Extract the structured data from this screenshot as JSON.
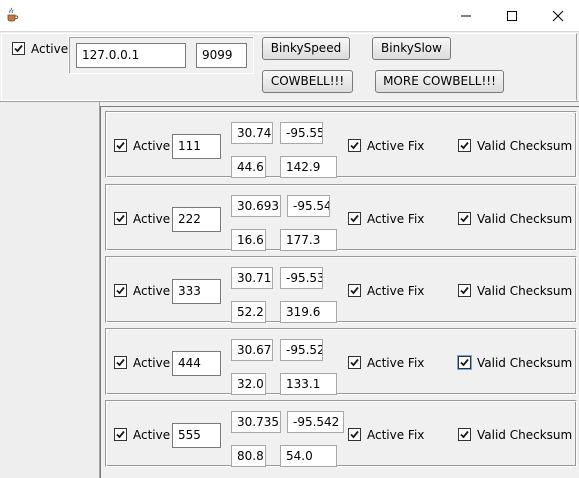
{
  "window": {
    "icon": "java-coffee-icon"
  },
  "top": {
    "active_label": "Active",
    "host": "127.0.0.1",
    "port": "9099",
    "buttons": {
      "binky_speed": "BinkySpeed",
      "binky_slow": "BinkySlow",
      "cowbell": "COWBELL!!!",
      "more_cowbell": "MORE COWBELL!!!"
    }
  },
  "rows": [
    {
      "active_label": "Active",
      "id": "111",
      "lat": "30.74",
      "lon": "-95.55",
      "v1": "44.6",
      "v2": "142.9",
      "fix_label": "Active Fix",
      "checksum_label": "Valid Checksum"
    },
    {
      "active_label": "Active",
      "id": "222",
      "lat": "30.693",
      "lon": "-95.54",
      "v1": "16.6",
      "v2": "177.3",
      "fix_label": "Active Fix",
      "checksum_label": "Valid Checksum"
    },
    {
      "active_label": "Active",
      "id": "333",
      "lat": "30.71",
      "lon": "-95.53",
      "v1": "52.2",
      "v2": "319.6",
      "fix_label": "Active Fix",
      "checksum_label": "Valid Checksum"
    },
    {
      "active_label": "Active",
      "id": "444",
      "lat": "30.67",
      "lon": "-95.52",
      "v1": "32.0",
      "v2": "133.1",
      "fix_label": "Active Fix",
      "checksum_label": "Valid Checksum"
    },
    {
      "active_label": "Active",
      "id": "555",
      "lat": "30.735",
      "lon": "-95.542",
      "v1": "80.8",
      "v2": "54.0",
      "fix_label": "Active Fix",
      "checksum_label": "Valid Checksum"
    }
  ]
}
